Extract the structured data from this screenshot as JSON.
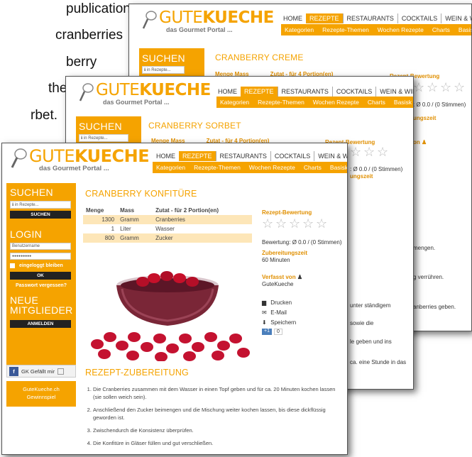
{
  "slide_text": [
    "publication",
    "cranberries",
    "berry",
    "the",
    "rbet."
  ],
  "brand": {
    "part1": "GUTE",
    "part2": "KUECHE",
    "tagline": "das Gourmet Portal ..."
  },
  "nav": {
    "top": [
      "HOME",
      "REZEPTE",
      "RESTAURANTS",
      "COCKTAILS",
      "WEIN & WINZER"
    ],
    "sub": [
      "Kategorien",
      "Rezepte-Themen",
      "Wochen Rezepte",
      "Charts",
      "Basisk"
    ]
  },
  "win_back": {
    "title": "CRANBERRY CREME",
    "col_menge": "Menge",
    "col_mass": "Mass",
    "col_zutat": "Zutat - für 4 Portion(en)",
    "rating_title": "Rezept-Bewertung",
    "rating_text": ": Ø 0.0 / (0 Stimmen)",
    "zeit_title": "ungszeit",
    "von": "on",
    "steps": [
      "mengen.",
      "g verrühren.",
      "anberries geben."
    ]
  },
  "win_mid": {
    "title": "CRANBERRY SORBET",
    "sidebar_search": "SUCHEN",
    "search_placeholder": "ℹ in Rezepte...",
    "col_menge": "Menge",
    "col_mass": "Mass",
    "col_zutat": "Zutat - für 4 Portion(en)",
    "rating_title": "Rezept-Bewertung",
    "rating_text": ": Ø 0.0 / (0 Stimmen)",
    "zeit_title": "ungszeit",
    "steps": [
      "unter ständigem",
      "sowie die",
      "le geben und ins",
      "ca. eine Stunde in das"
    ]
  },
  "win_front": {
    "title": "CRANBERRY KONFITÜRE",
    "sidebar": {
      "search_heading": "SUCHEN",
      "search_placeholder": "ℹ in Rezepte...",
      "search_button": "SUCHEN",
      "login_heading": "LOGIN",
      "username_placeholder": "Benutzername",
      "password_value": "●●●●●●●●●",
      "remember_label": "eingeloggt bleiben",
      "ok_button": "OK",
      "forgot_link": "Passwort vergessen?",
      "members_heading_1": "NEUE",
      "members_heading_2": "MITGLIEDER",
      "register_button": "ANMELDEN",
      "fb_text": "GK Gefällt mir",
      "promo_1": "GuteKueche.ch",
      "promo_2": "Gewinnspiel"
    },
    "ingredients": {
      "col_menge": "Menge",
      "col_mass": "Mass",
      "col_zutat": "Zutat - für 2 Portion(en)",
      "rows": [
        {
          "menge": "1300",
          "mass": "Gramm",
          "zutat": "Cranberries"
        },
        {
          "menge": "1",
          "mass": "Liter",
          "zutat": "Wasser"
        },
        {
          "menge": "800",
          "mass": "Gramm",
          "zutat": "Zucker"
        }
      ]
    },
    "rating": {
      "title": "Rezept-Bewertung",
      "text": "Bewertung: Ø 0.0 / (0 Stimmen)",
      "stars": 0
    },
    "prep": {
      "title": "Zubereitungszeit",
      "value": "60 Minuten"
    },
    "author": {
      "title": "Verfasst von",
      "name": "GuteKueche"
    },
    "actions": [
      "Drucken",
      "E-Mail",
      "Speichern"
    ],
    "plus_count": "0",
    "plus_label": "+1",
    "steps_title": "REZEPT-ZUBEREITUNG",
    "steps": [
      "Die Cranberries zusammen mit dem Wasser in einen Topf geben und für ca. 20 Minuten kochen lassen (sie sollen weich sein).",
      "Anschließend den Zucker beimengen und die Mischung weiter kochen lassen, bis diese dickflüssig geworden ist.",
      "Zwischendurch die Konsistenz überprüfen.",
      "Die Konfitüre in Gläser füllen und gut verschließen."
    ]
  },
  "colors": {
    "accent": "#f5a300",
    "dark": "#222222",
    "row_alt": "#fde6b8"
  }
}
